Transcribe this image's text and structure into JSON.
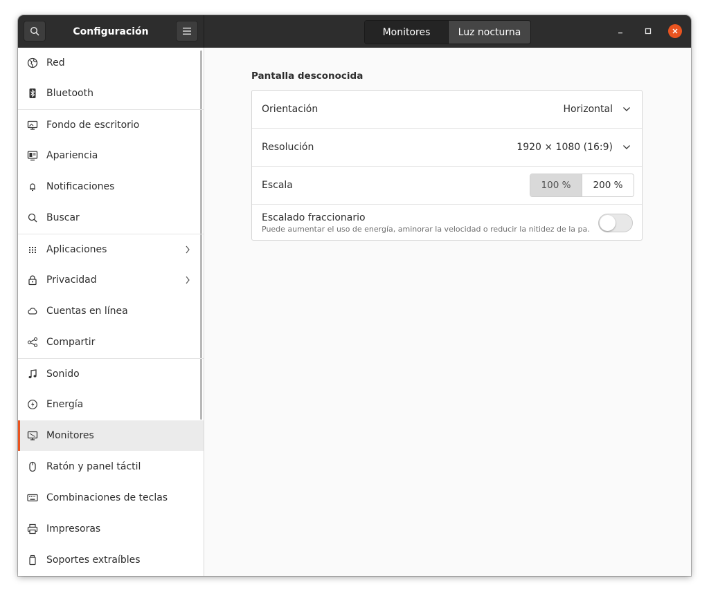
{
  "window": {
    "title": "Configuración",
    "tabs": [
      {
        "label": "Monitores",
        "active": true
      },
      {
        "label": "Luz nocturna",
        "active": false
      }
    ]
  },
  "colors": {
    "accent": "#e95420",
    "header_bg": "#2d2d2d"
  },
  "sidebar": {
    "items": [
      {
        "label": "Red",
        "icon": "globe-icon"
      },
      {
        "label": "Bluetooth",
        "icon": "bluetooth-icon"
      },
      {
        "label": "Fondo de escritorio",
        "icon": "desktop-background-icon"
      },
      {
        "label": "Apariencia",
        "icon": "appearance-icon"
      },
      {
        "label": "Notificaciones",
        "icon": "bell-icon"
      },
      {
        "label": "Buscar",
        "icon": "search-icon"
      },
      {
        "label": "Aplicaciones",
        "icon": "grid-icon"
      },
      {
        "label": "Privacidad",
        "icon": "lock-icon"
      },
      {
        "label": "Cuentas en línea",
        "icon": "cloud-icon"
      },
      {
        "label": "Compartir",
        "icon": "share-icon"
      },
      {
        "label": "Sonido",
        "icon": "music-note-icon"
      },
      {
        "label": "Energía",
        "icon": "power-icon"
      },
      {
        "label": "Monitores",
        "icon": "display-icon",
        "selected": true
      },
      {
        "label": "Ratón y panel táctil",
        "icon": "mouse-icon"
      },
      {
        "label": "Combinaciones de teclas",
        "icon": "keyboard-icon"
      },
      {
        "label": "Impresoras",
        "icon": "printer-icon"
      },
      {
        "label": "Soportes extraíbles",
        "icon": "removable-media-icon"
      }
    ]
  },
  "main": {
    "section_title": "Pantalla desconocida",
    "orientation": {
      "label": "Orientación",
      "value": "Horizontal"
    },
    "resolution": {
      "label": "Resolución",
      "value": "1920 × 1080 (16:9)"
    },
    "scale": {
      "label": "Escala",
      "options": [
        "100 %",
        "200 %"
      ],
      "selected": "100 %"
    },
    "fractional": {
      "title": "Escalado fraccionario",
      "subtitle": "Puede aumentar el uso de energía, aminorar la velocidad o reducir la nitidez de la pa…",
      "enabled": false
    }
  }
}
